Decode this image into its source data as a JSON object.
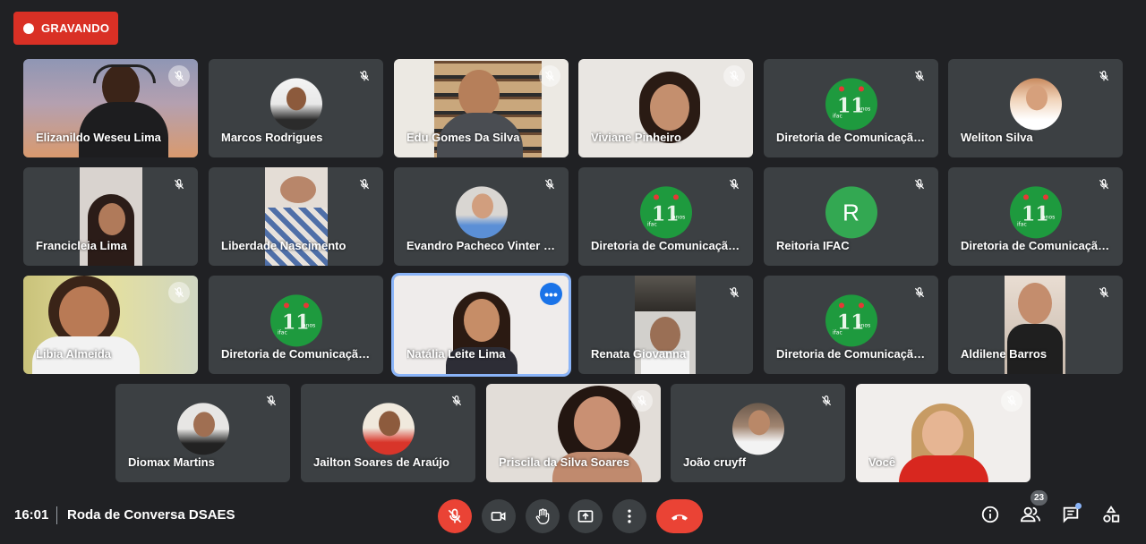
{
  "recording": {
    "label": "GRAVANDO"
  },
  "participants": [
    {
      "name": "Elizanildo Weseu Lima"
    },
    {
      "name": "Marcos Rodrigues"
    },
    {
      "name": "Edu Gomes Da Silva"
    },
    {
      "name": "Viviane Pinheiro"
    },
    {
      "name": "Diretoria de Comunicação Social"
    },
    {
      "name": "Weliton Silva"
    },
    {
      "name": "Francicleia Lima"
    },
    {
      "name": "Liberdade Nascimento"
    },
    {
      "name": "Evandro Pacheco Vinter Filho"
    },
    {
      "name": "Diretoria de Comunicação Social"
    },
    {
      "name": "Reitoria IFAC",
      "initial": "R"
    },
    {
      "name": "Diretoria de Comunicação Social"
    },
    {
      "name": "Libia Almeida"
    },
    {
      "name": "Diretoria de Comunicação Social"
    },
    {
      "name": "Natália Leite Lima"
    },
    {
      "name": "Renata Giovanna"
    },
    {
      "name": "Diretoria de Comunicação Social"
    },
    {
      "name": "Aldilene Barros"
    },
    {
      "name": "Diomax Martins"
    },
    {
      "name": "Jailton Soares de Araújo"
    },
    {
      "name": "Priscila da Silva Soares"
    },
    {
      "name": "João cruyff"
    },
    {
      "name": "Você"
    }
  ],
  "options_glyph": "•••",
  "footer": {
    "time": "16:01",
    "meeting_title": "Roda de Conversa DSAES",
    "participant_count": "23"
  },
  "colors": {
    "recording": "#d93025",
    "hangup": "#ea4335",
    "active_speaker": "#8ab4f8",
    "tile_bg": "#3c4043",
    "logo_green": "#1e9a3e"
  },
  "icons": [
    "mic-off-icon",
    "camera-icon",
    "raise-hand-icon",
    "present-screen-icon",
    "more-vert-icon",
    "call-end-icon",
    "info-icon",
    "people-icon",
    "chat-icon",
    "activities-icon"
  ]
}
